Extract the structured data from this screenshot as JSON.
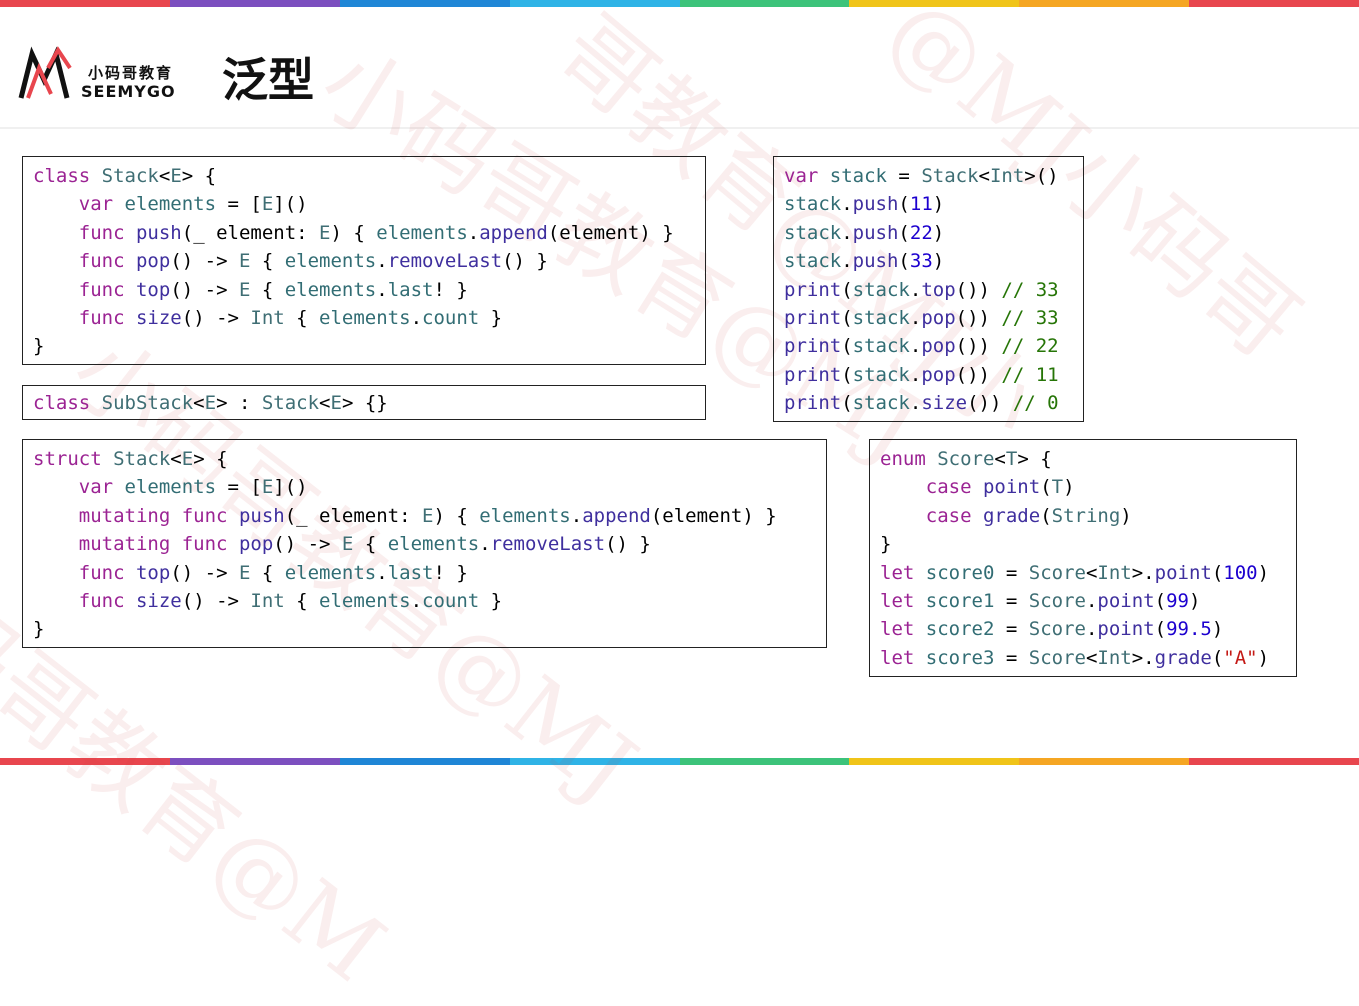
{
  "header": {
    "logo_cn": "小码哥教育",
    "logo_en": "SEEMYGO",
    "title": "泛型"
  },
  "colors": {
    "keyword": "#9b2393",
    "type": "#3f6e74",
    "function": "#3f2f9e",
    "number": "#1c00cf",
    "string": "#c41a16",
    "comment": "#267507",
    "rainbow": [
      "#e8464e",
      "#7c4fbf",
      "#1f86d6",
      "#2fb3e6",
      "#3cc37a",
      "#f0c419",
      "#f5a623",
      "#e8464e"
    ]
  },
  "code_blocks": [
    {
      "id": "class-stack",
      "lines": [
        [
          [
            "kw",
            "class"
          ],
          [
            "p",
            " "
          ],
          [
            "type",
            "Stack"
          ],
          [
            "p",
            "<"
          ],
          [
            "type",
            "E"
          ],
          [
            "p",
            "> {"
          ]
        ],
        [
          [
            "p",
            "    "
          ],
          [
            "kw",
            "var"
          ],
          [
            "p",
            " "
          ],
          [
            "mem",
            "elements"
          ],
          [
            "p",
            " = ["
          ],
          [
            "type",
            "E"
          ],
          [
            "p",
            "]()"
          ]
        ],
        [
          [
            "p",
            "    "
          ],
          [
            "kw",
            "func"
          ],
          [
            "p",
            " "
          ],
          [
            "fn",
            "push"
          ],
          [
            "p",
            "(_ element: "
          ],
          [
            "type",
            "E"
          ],
          [
            "p",
            ") { "
          ],
          [
            "mem",
            "elements"
          ],
          [
            "p",
            "."
          ],
          [
            "fn",
            "append"
          ],
          [
            "p",
            "(element) }"
          ]
        ],
        [
          [
            "p",
            "    "
          ],
          [
            "kw",
            "func"
          ],
          [
            "p",
            " "
          ],
          [
            "fn",
            "pop"
          ],
          [
            "p",
            "() -> "
          ],
          [
            "type",
            "E"
          ],
          [
            "p",
            " { "
          ],
          [
            "mem",
            "elements"
          ],
          [
            "p",
            "."
          ],
          [
            "fn",
            "removeLast"
          ],
          [
            "p",
            "() }"
          ]
        ],
        [
          [
            "p",
            "    "
          ],
          [
            "kw",
            "func"
          ],
          [
            "p",
            " "
          ],
          [
            "fn",
            "top"
          ],
          [
            "p",
            "() -> "
          ],
          [
            "type",
            "E"
          ],
          [
            "p",
            " { "
          ],
          [
            "mem",
            "elements"
          ],
          [
            "p",
            "."
          ],
          [
            "mem",
            "last"
          ],
          [
            "p",
            "! }"
          ]
        ],
        [
          [
            "p",
            "    "
          ],
          [
            "kw",
            "func"
          ],
          [
            "p",
            " "
          ],
          [
            "fn",
            "size"
          ],
          [
            "p",
            "() -> "
          ],
          [
            "type",
            "Int"
          ],
          [
            "p",
            " { "
          ],
          [
            "mem",
            "elements"
          ],
          [
            "p",
            "."
          ],
          [
            "mem",
            "count"
          ],
          [
            "p",
            " }"
          ]
        ],
        [
          [
            "p",
            "}"
          ]
        ]
      ]
    },
    {
      "id": "class-substack",
      "lines": [
        [
          [
            "kw",
            "class"
          ],
          [
            "p",
            " "
          ],
          [
            "type",
            "SubStack"
          ],
          [
            "p",
            "<"
          ],
          [
            "type",
            "E"
          ],
          [
            "p",
            "> : "
          ],
          [
            "type",
            "Stack"
          ],
          [
            "p",
            "<"
          ],
          [
            "type",
            "E"
          ],
          [
            "p",
            "> {}"
          ]
        ]
      ]
    },
    {
      "id": "struct-stack",
      "lines": [
        [
          [
            "kw",
            "struct"
          ],
          [
            "p",
            " "
          ],
          [
            "type",
            "Stack"
          ],
          [
            "p",
            "<"
          ],
          [
            "type",
            "E"
          ],
          [
            "p",
            "> {"
          ]
        ],
        [
          [
            "p",
            "    "
          ],
          [
            "kw",
            "var"
          ],
          [
            "p",
            " "
          ],
          [
            "mem",
            "elements"
          ],
          [
            "p",
            " = ["
          ],
          [
            "type",
            "E"
          ],
          [
            "p",
            "]()"
          ]
        ],
        [
          [
            "p",
            "    "
          ],
          [
            "kw",
            "mutating"
          ],
          [
            "p",
            " "
          ],
          [
            "kw",
            "func"
          ],
          [
            "p",
            " "
          ],
          [
            "fn",
            "push"
          ],
          [
            "p",
            "(_ element: "
          ],
          [
            "type",
            "E"
          ],
          [
            "p",
            ") { "
          ],
          [
            "mem",
            "elements"
          ],
          [
            "p",
            "."
          ],
          [
            "fn",
            "append"
          ],
          [
            "p",
            "(element) }"
          ]
        ],
        [
          [
            "p",
            "    "
          ],
          [
            "kw",
            "mutating"
          ],
          [
            "p",
            " "
          ],
          [
            "kw",
            "func"
          ],
          [
            "p",
            " "
          ],
          [
            "fn",
            "pop"
          ],
          [
            "p",
            "() -> "
          ],
          [
            "type",
            "E"
          ],
          [
            "p",
            " { "
          ],
          [
            "mem",
            "elements"
          ],
          [
            "p",
            "."
          ],
          [
            "fn",
            "removeLast"
          ],
          [
            "p",
            "() }"
          ]
        ],
        [
          [
            "p",
            "    "
          ],
          [
            "kw",
            "func"
          ],
          [
            "p",
            " "
          ],
          [
            "fn",
            "top"
          ],
          [
            "p",
            "() -> "
          ],
          [
            "type",
            "E"
          ],
          [
            "p",
            " { "
          ],
          [
            "mem",
            "elements"
          ],
          [
            "p",
            "."
          ],
          [
            "mem",
            "last"
          ],
          [
            "p",
            "! }"
          ]
        ],
        [
          [
            "p",
            "    "
          ],
          [
            "kw",
            "func"
          ],
          [
            "p",
            " "
          ],
          [
            "fn",
            "size"
          ],
          [
            "p",
            "() -> "
          ],
          [
            "type",
            "Int"
          ],
          [
            "p",
            " { "
          ],
          [
            "mem",
            "elements"
          ],
          [
            "p",
            "."
          ],
          [
            "mem",
            "count"
          ],
          [
            "p",
            " }"
          ]
        ],
        [
          [
            "p",
            "}"
          ]
        ]
      ]
    },
    {
      "id": "stack-usage",
      "lines": [
        [
          [
            "kw",
            "var"
          ],
          [
            "p",
            " "
          ],
          [
            "mem",
            "stack"
          ],
          [
            "p",
            " = "
          ],
          [
            "type",
            "Stack"
          ],
          [
            "p",
            "<"
          ],
          [
            "type",
            "Int"
          ],
          [
            "p",
            ">()"
          ]
        ],
        [
          [
            "mem",
            "stack"
          ],
          [
            "p",
            "."
          ],
          [
            "fn",
            "push"
          ],
          [
            "p",
            "("
          ],
          [
            "num",
            "11"
          ],
          [
            "p",
            ")"
          ]
        ],
        [
          [
            "mem",
            "stack"
          ],
          [
            "p",
            "."
          ],
          [
            "fn",
            "push"
          ],
          [
            "p",
            "("
          ],
          [
            "num",
            "22"
          ],
          [
            "p",
            ")"
          ]
        ],
        [
          [
            "mem",
            "stack"
          ],
          [
            "p",
            "."
          ],
          [
            "fn",
            "push"
          ],
          [
            "p",
            "("
          ],
          [
            "num",
            "33"
          ],
          [
            "p",
            ")"
          ]
        ],
        [
          [
            "fn",
            "print"
          ],
          [
            "p",
            "("
          ],
          [
            "mem",
            "stack"
          ],
          [
            "p",
            "."
          ],
          [
            "fn",
            "top"
          ],
          [
            "p",
            "()) "
          ],
          [
            "cmt",
            "// 33"
          ]
        ],
        [
          [
            "fn",
            "print"
          ],
          [
            "p",
            "("
          ],
          [
            "mem",
            "stack"
          ],
          [
            "p",
            "."
          ],
          [
            "fn",
            "pop"
          ],
          [
            "p",
            "()) "
          ],
          [
            "cmt",
            "// 33"
          ]
        ],
        [
          [
            "fn",
            "print"
          ],
          [
            "p",
            "("
          ],
          [
            "mem",
            "stack"
          ],
          [
            "p",
            "."
          ],
          [
            "fn",
            "pop"
          ],
          [
            "p",
            "()) "
          ],
          [
            "cmt",
            "// 22"
          ]
        ],
        [
          [
            "fn",
            "print"
          ],
          [
            "p",
            "("
          ],
          [
            "mem",
            "stack"
          ],
          [
            "p",
            "."
          ],
          [
            "fn",
            "pop"
          ],
          [
            "p",
            "()) "
          ],
          [
            "cmt",
            "// 11"
          ]
        ],
        [
          [
            "fn",
            "print"
          ],
          [
            "p",
            "("
          ],
          [
            "mem",
            "stack"
          ],
          [
            "p",
            "."
          ],
          [
            "fn",
            "size"
          ],
          [
            "p",
            "()) "
          ],
          [
            "cmt",
            "// 0"
          ]
        ]
      ]
    },
    {
      "id": "enum-score",
      "lines": [
        [
          [
            "kw",
            "enum"
          ],
          [
            "p",
            " "
          ],
          [
            "type",
            "Score"
          ],
          [
            "p",
            "<"
          ],
          [
            "type",
            "T"
          ],
          [
            "p",
            "> {"
          ]
        ],
        [
          [
            "p",
            "    "
          ],
          [
            "kw",
            "case"
          ],
          [
            "p",
            " "
          ],
          [
            "fn",
            "point"
          ],
          [
            "p",
            "("
          ],
          [
            "type",
            "T"
          ],
          [
            "p",
            ")"
          ]
        ],
        [
          [
            "p",
            "    "
          ],
          [
            "kw",
            "case"
          ],
          [
            "p",
            " "
          ],
          [
            "fn",
            "grade"
          ],
          [
            "p",
            "("
          ],
          [
            "type",
            "String"
          ],
          [
            "p",
            ")"
          ]
        ],
        [
          [
            "p",
            "}"
          ]
        ],
        [
          [
            "kw",
            "let"
          ],
          [
            "p",
            " "
          ],
          [
            "mem",
            "score0"
          ],
          [
            "p",
            " = "
          ],
          [
            "type",
            "Score"
          ],
          [
            "p",
            "<"
          ],
          [
            "type",
            "Int"
          ],
          [
            "p",
            ">."
          ],
          [
            "fn",
            "point"
          ],
          [
            "p",
            "("
          ],
          [
            "num",
            "100"
          ],
          [
            "p",
            ")"
          ]
        ],
        [
          [
            "kw",
            "let"
          ],
          [
            "p",
            " "
          ],
          [
            "mem",
            "score1"
          ],
          [
            "p",
            " = "
          ],
          [
            "type",
            "Score"
          ],
          [
            "p",
            "."
          ],
          [
            "fn",
            "point"
          ],
          [
            "p",
            "("
          ],
          [
            "num",
            "99"
          ],
          [
            "p",
            ")"
          ]
        ],
        [
          [
            "kw",
            "let"
          ],
          [
            "p",
            " "
          ],
          [
            "mem",
            "score2"
          ],
          [
            "p",
            " = "
          ],
          [
            "type",
            "Score"
          ],
          [
            "p",
            "."
          ],
          [
            "fn",
            "point"
          ],
          [
            "p",
            "("
          ],
          [
            "num",
            "99.5"
          ],
          [
            "p",
            ")"
          ]
        ],
        [
          [
            "kw",
            "let"
          ],
          [
            "p",
            " "
          ],
          [
            "mem",
            "score3"
          ],
          [
            "p",
            " = "
          ],
          [
            "type",
            "Score"
          ],
          [
            "p",
            "<"
          ],
          [
            "type",
            "Int"
          ],
          [
            "p",
            ">."
          ],
          [
            "fn",
            "grade"
          ],
          [
            "p",
            "("
          ],
          [
            "str",
            "\"A\""
          ],
          [
            "p",
            ")"
          ]
        ]
      ]
    }
  ]
}
